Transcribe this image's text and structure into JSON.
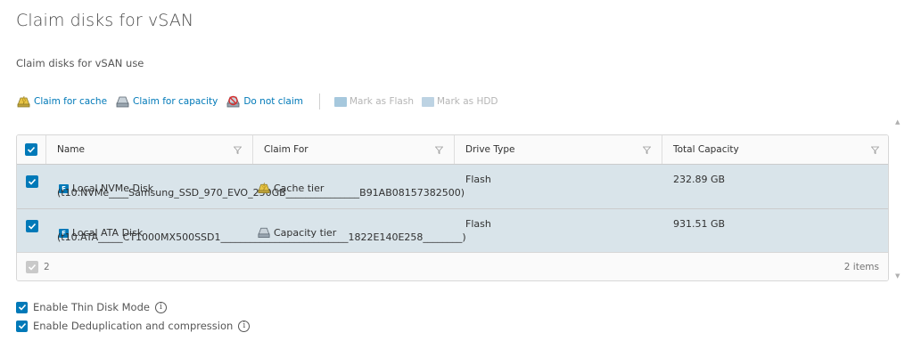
{
  "page": {
    "title": "Claim disks for vSAN",
    "subtitle": "Claim disks for vSAN use"
  },
  "toolbar": {
    "claim_cache": "Claim for cache",
    "claim_capacity": "Claim for capacity",
    "do_not_claim": "Do not claim",
    "mark_flash": "Mark as Flash",
    "mark_hdd": "Mark as HDD"
  },
  "grid": {
    "columns": [
      "Name",
      "Claim For",
      "Drive Type",
      "Total Capacity"
    ],
    "rows": [
      {
        "name": "Local NVMe Disk",
        "id": "(t10.NVMe____Samsung_SSD_970_EVO_250GB_______________B91AB08157382500)",
        "claim_for": "Cache tier",
        "drive_type": "Flash",
        "capacity": "232.89 GB",
        "selected": true
      },
      {
        "name": "Local ATA Disk",
        "id": "(t10.ATA_____CT1000MX500SSD1__________________________1822E140E258________)",
        "claim_for": "Capacity tier",
        "drive_type": "Flash",
        "capacity": "931.51 GB",
        "selected": true
      }
    ],
    "footer": {
      "selected_count": "2",
      "total": "2 items"
    }
  },
  "options": {
    "thin_disk": "Enable Thin Disk Mode",
    "dedup": "Enable Deduplication and compression"
  },
  "colors": {
    "accent": "#0079b8",
    "row_selected": "#d9e4ea"
  }
}
